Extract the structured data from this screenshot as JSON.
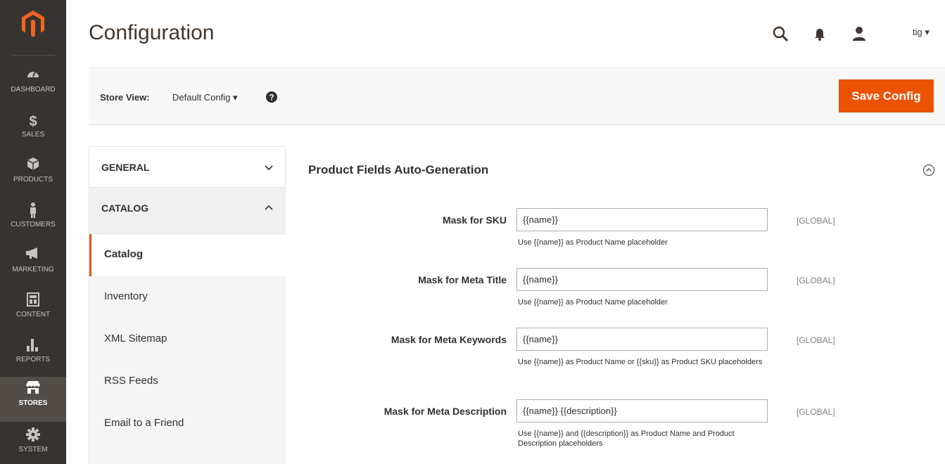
{
  "sidebar": {
    "items": [
      {
        "label": "DASHBOARD",
        "icon": "dashboard-icon"
      },
      {
        "label": "SALES",
        "icon": "dollar-icon"
      },
      {
        "label": "PRODUCTS",
        "icon": "cube-icon"
      },
      {
        "label": "CUSTOMERS",
        "icon": "person-icon"
      },
      {
        "label": "MARKETING",
        "icon": "megaphone-icon"
      },
      {
        "label": "CONTENT",
        "icon": "layout-icon"
      },
      {
        "label": "REPORTS",
        "icon": "bar-chart-icon"
      },
      {
        "label": "STORES",
        "icon": "store-icon"
      },
      {
        "label": "SYSTEM",
        "icon": "gear-icon"
      }
    ]
  },
  "header": {
    "title": "Configuration",
    "user": "tig ▾"
  },
  "store_view": {
    "label": "Store View:",
    "value": "Default Config  ▾",
    "save_label": "Save Config"
  },
  "tabs": {
    "general": "GENERAL",
    "catalog": "CATALOG",
    "sub_items": [
      "Catalog",
      "Inventory",
      "XML Sitemap",
      "RSS Feeds",
      "Email to a Friend"
    ]
  },
  "section": {
    "title": "Product Fields Auto-Generation",
    "fields": [
      {
        "label": "Mask for SKU",
        "value": "{{name}}",
        "note": "Use {{name}} as Product Name placeholder",
        "scope": "[GLOBAL]"
      },
      {
        "label": "Mask for Meta Title",
        "value": "{{name}}",
        "note": "Use {{name}} as Product Name placeholder",
        "scope": "[GLOBAL]"
      },
      {
        "label": "Mask for Meta Keywords",
        "value": "{{name}}",
        "note": "Use {{name}} as Product Name or {{sku}} as Product SKU placeholders",
        "scope": "[GLOBAL]"
      },
      {
        "label": "Mask for Meta Description",
        "value": "{{name}} {{description}}",
        "note": "Use {{name}} and {{description}} as Product Name and Product Description placeholders",
        "scope": "[GLOBAL]"
      }
    ]
  },
  "colors": {
    "accent": "#eb5202",
    "sidebar_bg": "#373330"
  }
}
